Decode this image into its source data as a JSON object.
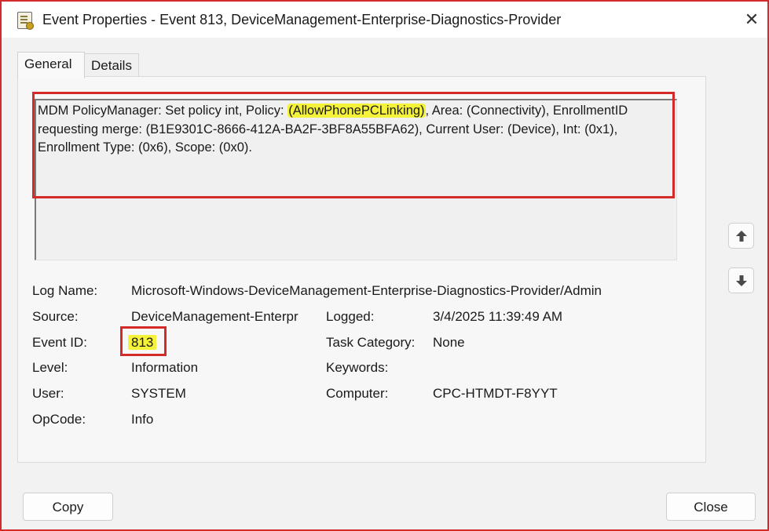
{
  "window": {
    "title": "Event Properties - Event 813, DeviceManagement-Enterprise-Diagnostics-Provider",
    "close_glyph": "✕"
  },
  "tabs": [
    {
      "label": "General",
      "active": true
    },
    {
      "label": "Details",
      "active": false
    }
  ],
  "message": {
    "part1": "MDM PolicyManager: Set policy int, Policy: ",
    "highlight": "(AllowPhonePCLinking)",
    "part2": ", Area: (Connectivity), EnrollmentID requesting merge: (B1E9301C-8666-412A-BA2F-3BF8A55BFA62), Current User: (Device), Int: (0x1), Enrollment Type: (0x6), Scope: (0x0)."
  },
  "fields": {
    "log_name_label": "Log Name:",
    "log_name_value": "Microsoft-Windows-DeviceManagement-Enterprise-Diagnostics-Provider/Admin",
    "source_label": "Source:",
    "source_value": "DeviceManagement-Enterpr",
    "logged_label": "Logged:",
    "logged_value": "3/4/2025 11:39:49 AM",
    "event_id_label": "Event ID:",
    "event_id_value": "813",
    "task_category_label": "Task Category:",
    "task_category_value": "None",
    "level_label": "Level:",
    "level_value": "Information",
    "keywords_label": "Keywords:",
    "keywords_value": "",
    "user_label": "User:",
    "user_value": "SYSTEM",
    "computer_label": "Computer:",
    "computer_value": "CPC-HTMDT-F8YYT",
    "opcode_label": "OpCode:",
    "opcode_value": "Info"
  },
  "buttons": {
    "copy": "Copy",
    "close": "Close"
  },
  "icons": {
    "title": "event-log-icon",
    "up": "arrow-up-icon",
    "down": "arrow-down-icon"
  },
  "colors": {
    "annotation_red": "#d42a2a",
    "highlight_yellow": "#f5f23a"
  }
}
